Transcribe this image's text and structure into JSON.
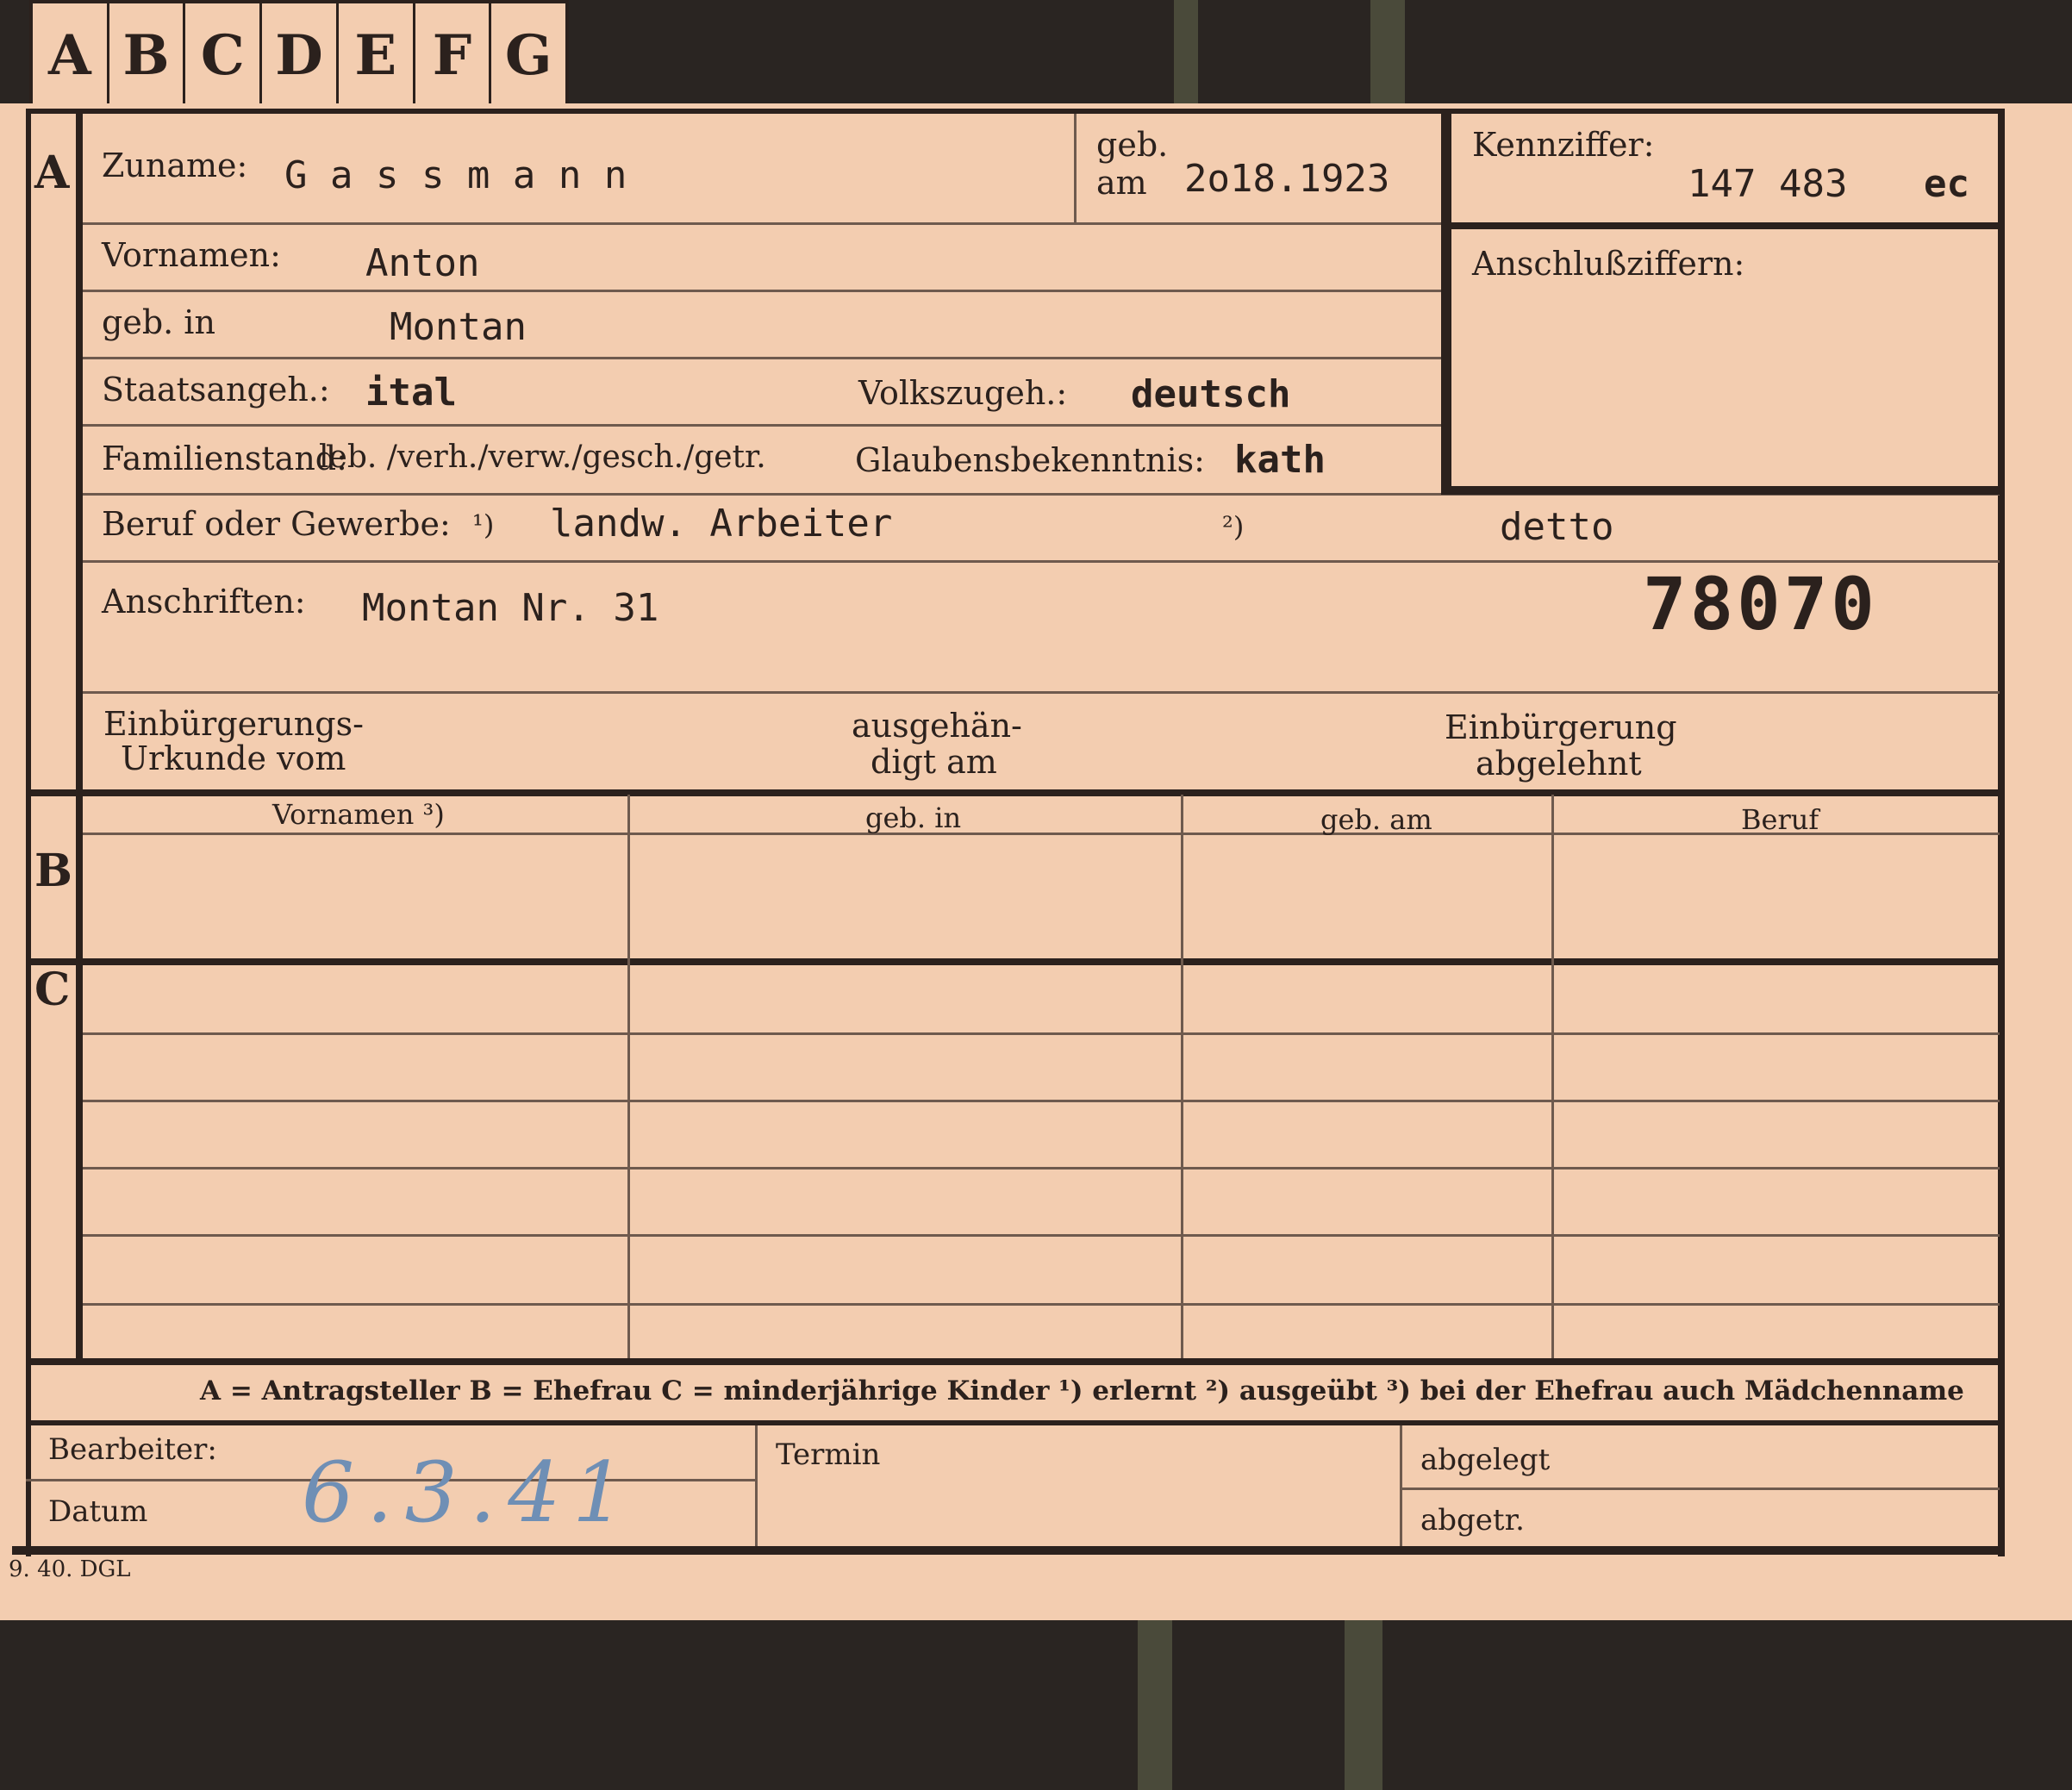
{
  "tabs": [
    "A",
    "B",
    "C",
    "D",
    "E",
    "F",
    "G"
  ],
  "sections": {
    "a": "A",
    "b": "B",
    "c": "C"
  },
  "fields": {
    "zuname_label": "Zuname:",
    "zuname_value": "G a s s m a n n",
    "geb_label_1": "geb.",
    "geb_label_2": "am",
    "geb_am_value": "2o18.1923",
    "kennziffer_label": "Kennziffer:",
    "kennziffer_value": "147 483",
    "kennziffer_suffix": "ec",
    "anschluss_label": "Anschlußziffern:",
    "vornamen_label": "Vornamen:",
    "vornamen_value": "Anton",
    "geb_in_label": "geb. in",
    "geb_in_value": "Montan",
    "staats_label": "Staatsangeh.:",
    "staats_value": "ital",
    "volks_label": "Volkszugeh.:",
    "volks_value": "deutsch",
    "familienstand_label": "Familienstand:",
    "familienstand_options": "leb. /verh./verw./gesch./getr.",
    "glaubens_label": "Glaubensbekenntnis:",
    "glaubens_value": "kath",
    "beruf_label": "Beruf oder Gewerbe:",
    "beruf_mark_1": "¹)",
    "beruf_value_1": "landw. Arbeiter",
    "beruf_mark_2": "²)",
    "beruf_value_2": "detto",
    "anschriften_label": "Anschriften:",
    "anschriften_value": "Montan Nr. 31",
    "stamp_number": "78070",
    "einb_urkunde_1": "Einbürgerungs-",
    "einb_urkunde_2": "Urkunde vom",
    "ausgehaendigt_1": "ausgehän-",
    "ausgehaendigt_2": "digt am",
    "einb_abgelehnt_1": "Einbürgerung",
    "einb_abgelehnt_2": "abgelehnt"
  },
  "table": {
    "headers": [
      "Vornamen ³)",
      "geb. in",
      "geb. am",
      "Beruf"
    ]
  },
  "legend": "A = Antragsteller   B = Ehefrau   C = minderjährige Kinder   ¹) erlernt   ²) ausgeübt   ³) bei der Ehefrau auch Mädchenname",
  "footer": {
    "bearbeiter_label": "Bearbeiter:",
    "datum_label": "Datum",
    "datum_value": "6.3.41",
    "termin_label": "Termin",
    "abgelegt_label": "abgelegt",
    "abgetr_label": "abgetr."
  },
  "print_mark": "9. 40. DGL"
}
